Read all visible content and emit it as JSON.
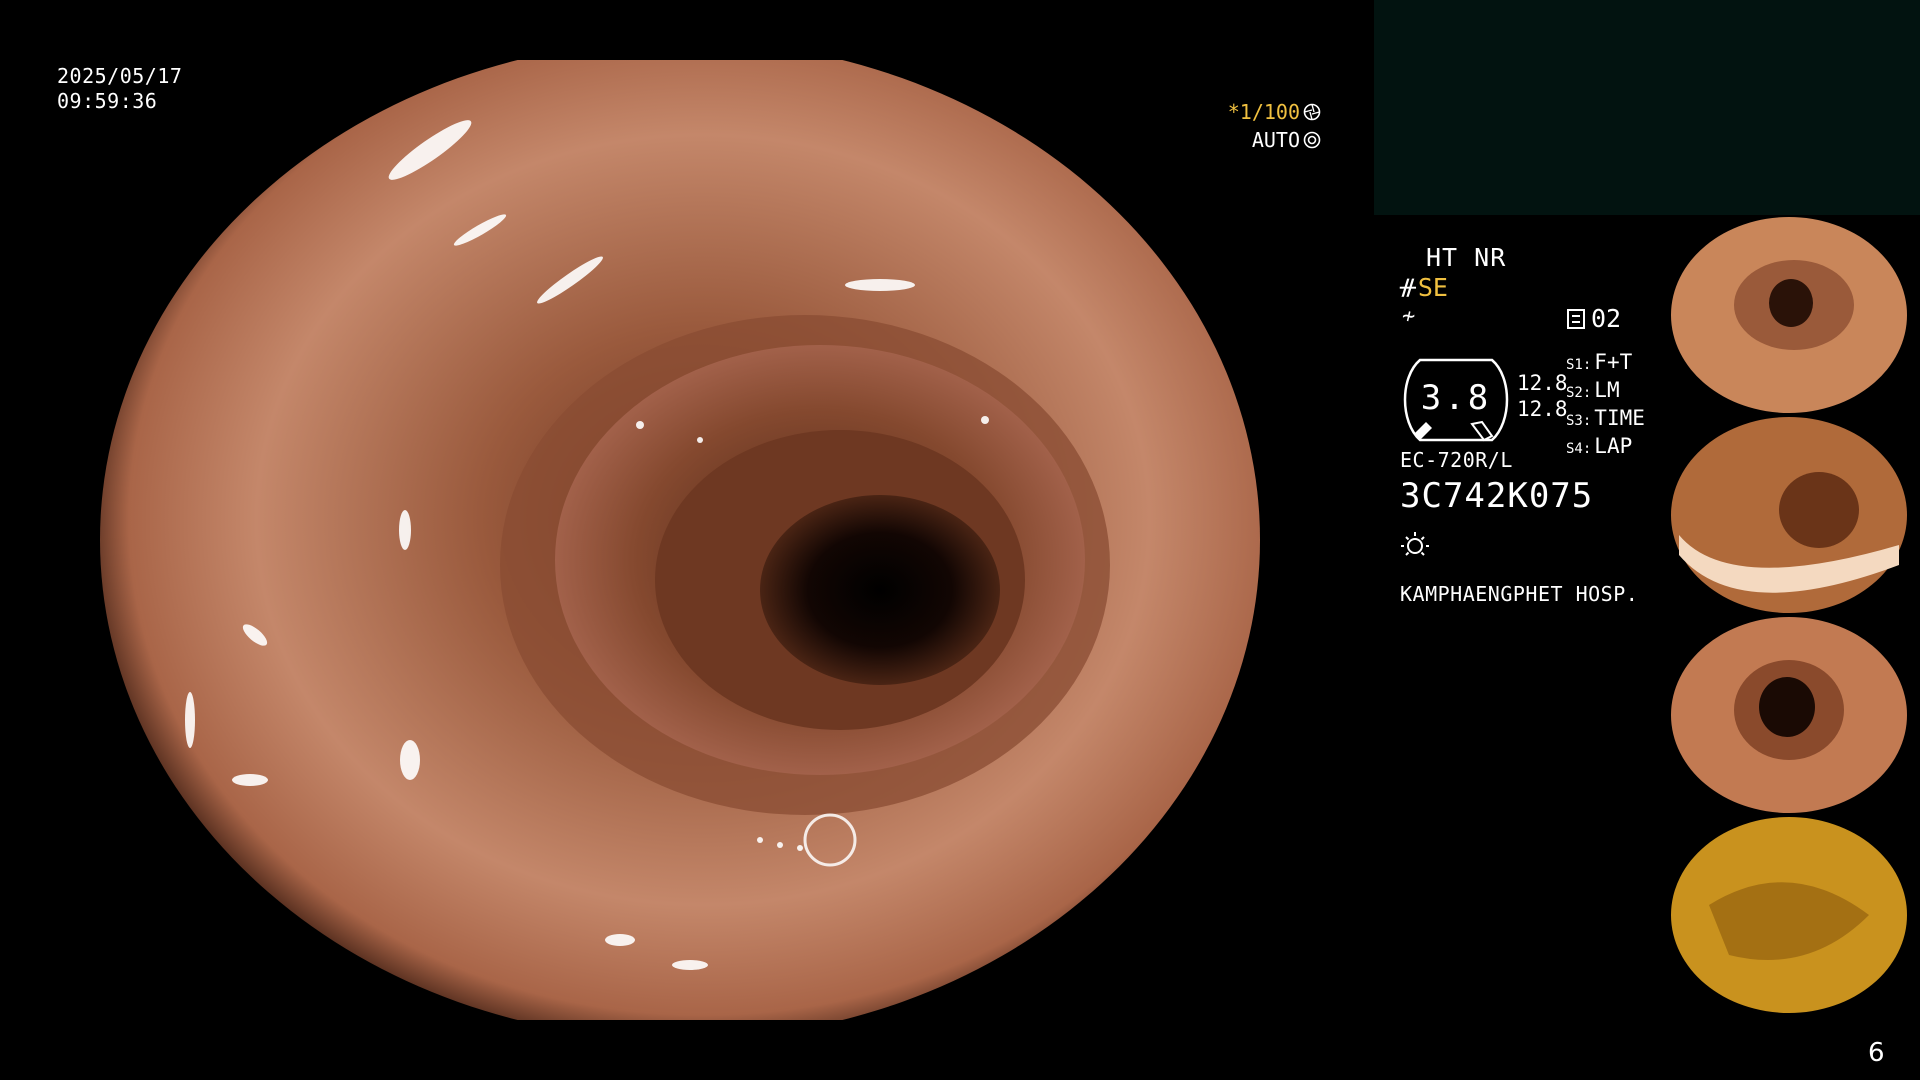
{
  "overlay": {
    "date": "2025/05/17",
    "time": "09:59:36",
    "shutter_speed": "*1/100",
    "exposure_mode": "AUTO"
  },
  "status": {
    "enhancement": "HT NR",
    "mode": "SE",
    "page_indicator": "02",
    "gauge_value": "3.8",
    "gauge_side_values": [
      "12.8",
      "12.8"
    ]
  },
  "scope_settings": [
    {
      "label": "S1:",
      "value": "F+T"
    },
    {
      "label": "S2:",
      "value": "LM"
    },
    {
      "label": "S3:",
      "value": "TIME"
    },
    {
      "label": "S4:",
      "value": "LAP"
    }
  ],
  "device": {
    "model": "EC-720R/L",
    "serial": "3C742K075",
    "hospital": "KAMPHAENGPHET HOSP."
  },
  "thumbnails": [
    {
      "name": "thumbnail-1",
      "tone": "#c9865a"
    },
    {
      "name": "thumbnail-2",
      "tone": "#b06a3a"
    },
    {
      "name": "thumbnail-3",
      "tone": "#c27a52"
    },
    {
      "name": "thumbnail-4",
      "tone": "#c9921e"
    }
  ],
  "slide_number": "6",
  "colors": {
    "background": "#000000",
    "accent_yellow": "#f0c040",
    "tissue": "#b87456"
  },
  "icons": [
    "shutter-icon",
    "auto-exposure-icon",
    "mode-icon",
    "filter-icon",
    "document-icon",
    "light-icon"
  ]
}
